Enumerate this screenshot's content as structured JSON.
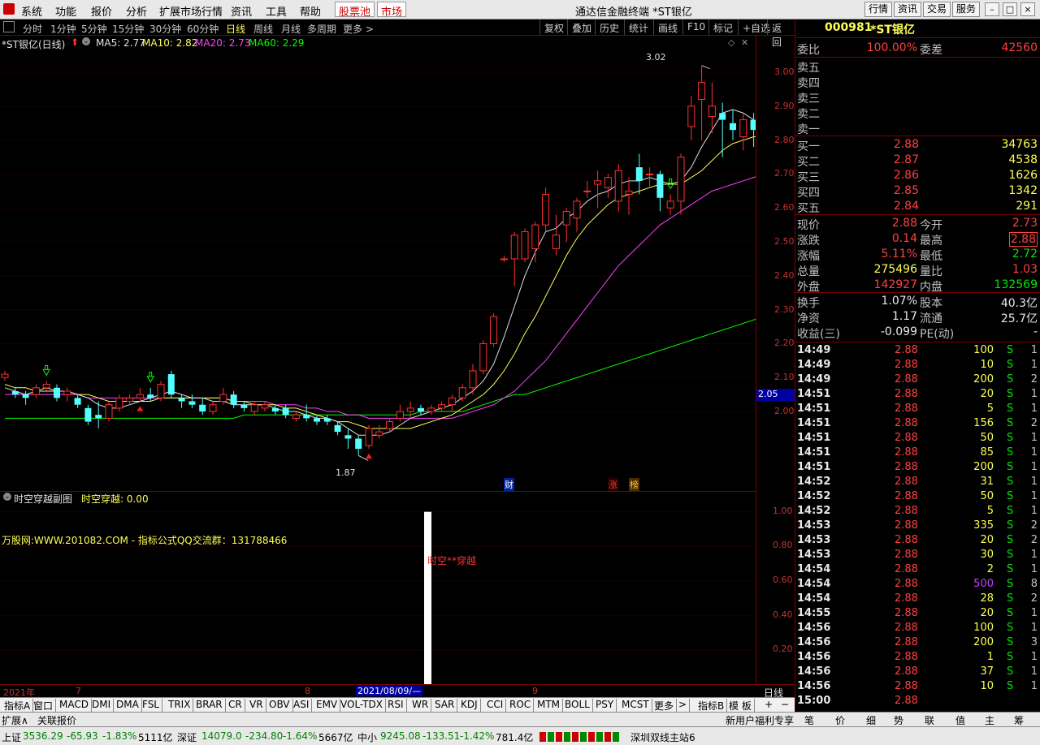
{
  "menubar": {
    "items": [
      "系统",
      "功能",
      "报价",
      "分析",
      "扩展市场行情",
      "资讯",
      "工具",
      "帮助"
    ],
    "tag1": "股票池",
    "tag2": "市场",
    "title": "通达信金融终端 *ST银亿",
    "right_buttons": [
      "行情",
      "资讯",
      "交易",
      "服务"
    ]
  },
  "periodbar": {
    "periods": [
      "分时",
      "1分钟",
      "5分钟",
      "15分钟",
      "30分钟",
      "60分钟",
      "日线",
      "周线",
      "月线",
      "多周期",
      "更多 >"
    ],
    "active": "日线",
    "tools": [
      "复权",
      "叠加",
      "历史",
      "统计",
      "画线",
      "F10",
      "标记",
      "+自选",
      "返回"
    ]
  },
  "chart_header": {
    "title": "*ST银亿(日线)",
    "ma5": "MA5: 2.77",
    "ma10": "MA10: 2.82",
    "ma20": "MA20: 2.73",
    "ma60": "MA60: 2.29",
    "high_label": "3.02",
    "low_label": "1.87",
    "marker_cai": "财",
    "marker_zhang": "涨",
    "marker_bang": "榜"
  },
  "sub_header": {
    "title": "时空穿越副图",
    "value": "时空穿越: 0.00",
    "watermark": "万股网:WWW.201082.COM - 指标公式QQ交流群：131788466",
    "bar_label": "时空**穿越"
  },
  "yaxis": {
    "main": [
      "3.00",
      "2.90",
      "2.80",
      "2.70",
      "2.60",
      "2.50",
      "2.40",
      "2.30",
      "2.20",
      "2.10",
      "2.00"
    ],
    "last": "2.05",
    "sub": [
      "1.00",
      "0.80",
      "0.60",
      "0.40",
      "0.20"
    ]
  },
  "xaxis": {
    "labels": [
      "2021年",
      "7",
      "8",
      "9"
    ],
    "cursor_date": "2021/08/09/—",
    "period": "日线",
    "buttons": [
      "+",
      "−"
    ]
  },
  "tabbar": [
    "指标A",
    "窗口",
    "MACD",
    "DMI",
    "DMA",
    "FSL",
    "TRIX",
    "BRAR",
    "CR",
    "VR",
    "OBV",
    "ASI",
    "EMV",
    "VOL-TDX",
    "RSI",
    "WR",
    "SAR",
    "KDJ",
    "CCI",
    "ROC",
    "MTM",
    "BOLL",
    "PSY",
    "MCST",
    "更多",
    ">",
    "指标B",
    "模 板"
  ],
  "extbar": {
    "left": [
      "扩展∧",
      "关联报价"
    ],
    "right": "新用户福利专享",
    "tabs": [
      "笔",
      "价",
      "细",
      "势",
      "联",
      "值",
      "主",
      "筹"
    ]
  },
  "statusbar": {
    "sh": {
      "name": "上证",
      "val": "3536.29",
      "chg": "-65.93",
      "pct": "-1.83%",
      "amt": "5111亿"
    },
    "sz": {
      "name": "深证",
      "val": "14079.0",
      "chg": "-234.80",
      "pct": "-1.64%",
      "amt": "5667亿"
    },
    "zx": {
      "name": "中小",
      "val": "9245.08",
      "chg": "-133.51",
      "pct": "-1.42%",
      "amt": "781.4亿"
    },
    "server": "深圳双线主站6"
  },
  "quote": {
    "code": "000981",
    "name": "*ST银亿",
    "weibi_label": "委比",
    "weibi": "100.00%",
    "weicha_label": "委差",
    "weicha": "42560",
    "sells": [
      "卖五",
      "卖四",
      "卖三",
      "卖二",
      "卖一"
    ],
    "buys": [
      {
        "label": "买一",
        "price": "2.88",
        "vol": "34763"
      },
      {
        "label": "买二",
        "price": "2.87",
        "vol": "4538"
      },
      {
        "label": "买三",
        "price": "2.86",
        "vol": "1626"
      },
      {
        "label": "买四",
        "price": "2.85",
        "vol": "1342"
      },
      {
        "label": "买五",
        "price": "2.84",
        "vol": "291"
      }
    ],
    "stats": [
      {
        "l1": "现价",
        "v1": "2.88",
        "l2": "今开",
        "v2": "2.73"
      },
      {
        "l1": "涨跌",
        "v1": "0.14",
        "l2": "最高",
        "v2": "2.88"
      },
      {
        "l1": "涨幅",
        "v1": "5.11%",
        "l2": "最低",
        "v2": "2.72"
      },
      {
        "l1": "总量",
        "v1": "275496",
        "l2": "量比",
        "v2": "1.03"
      },
      {
        "l1": "外盘",
        "v1": "142927",
        "l2": "内盘",
        "v2": "132569"
      }
    ],
    "fin": [
      {
        "l1": "换手",
        "v1": "1.07%",
        "l2": "股本",
        "v2": "40.3亿"
      },
      {
        "l1": "净资",
        "v1": "1.17",
        "l2": "流通",
        "v2": "25.7亿"
      },
      {
        "l1": "收益(三)",
        "v1": "-0.099",
        "l2": "PE(动)",
        "v2": "-"
      }
    ],
    "ticks": [
      {
        "t": "14:49",
        "p": "2.88",
        "v": "100",
        "s": "S",
        "n": "1"
      },
      {
        "t": "14:49",
        "p": "2.88",
        "v": "10",
        "s": "S",
        "n": "1"
      },
      {
        "t": "14:49",
        "p": "2.88",
        "v": "200",
        "s": "S",
        "n": "2"
      },
      {
        "t": "14:51",
        "p": "2.88",
        "v": "20",
        "s": "S",
        "n": "1"
      },
      {
        "t": "14:51",
        "p": "2.88",
        "v": "5",
        "s": "S",
        "n": "1"
      },
      {
        "t": "14:51",
        "p": "2.88",
        "v": "156",
        "s": "S",
        "n": "2"
      },
      {
        "t": "14:51",
        "p": "2.88",
        "v": "50",
        "s": "S",
        "n": "1"
      },
      {
        "t": "14:51",
        "p": "2.88",
        "v": "85",
        "s": "S",
        "n": "1"
      },
      {
        "t": "14:51",
        "p": "2.88",
        "v": "200",
        "s": "S",
        "n": "1"
      },
      {
        "t": "14:52",
        "p": "2.88",
        "v": "31",
        "s": "S",
        "n": "1"
      },
      {
        "t": "14:52",
        "p": "2.88",
        "v": "50",
        "s": "S",
        "n": "1"
      },
      {
        "t": "14:52",
        "p": "2.88",
        "v": "5",
        "s": "S",
        "n": "1"
      },
      {
        "t": "14:53",
        "p": "2.88",
        "v": "335",
        "s": "S",
        "n": "2"
      },
      {
        "t": "14:53",
        "p": "2.88",
        "v": "20",
        "s": "S",
        "n": "2"
      },
      {
        "t": "14:53",
        "p": "2.88",
        "v": "30",
        "s": "S",
        "n": "1"
      },
      {
        "t": "14:54",
        "p": "2.88",
        "v": "2",
        "s": "S",
        "n": "1"
      },
      {
        "t": "14:54",
        "p": "2.88",
        "v": "500",
        "s": "S",
        "n": "8"
      },
      {
        "t": "14:54",
        "p": "2.88",
        "v": "28",
        "s": "S",
        "n": "2"
      },
      {
        "t": "14:55",
        "p": "2.88",
        "v": "20",
        "s": "S",
        "n": "1"
      },
      {
        "t": "14:56",
        "p": "2.88",
        "v": "100",
        "s": "S",
        "n": "1"
      },
      {
        "t": "14:56",
        "p": "2.88",
        "v": "200",
        "s": "S",
        "n": "3"
      },
      {
        "t": "14:56",
        "p": "2.88",
        "v": "1",
        "s": "S",
        "n": "1"
      },
      {
        "t": "14:56",
        "p": "2.88",
        "v": "37",
        "s": "S",
        "n": "1"
      },
      {
        "t": "14:56",
        "p": "2.88",
        "v": "10",
        "s": "S",
        "n": "1"
      },
      {
        "t": "15:00",
        "p": "2.88",
        "v": "",
        "s": "",
        "n": ""
      }
    ]
  },
  "chart_data": {
    "type": "candlestick",
    "title": "*ST银亿(日线)",
    "ylim": [
      1.78,
      3.06
    ],
    "ohlc": [
      [
        2.1,
        2.12,
        2.09,
        2.11
      ],
      [
        2.06,
        2.07,
        2.04,
        2.05
      ],
      [
        2.05,
        2.06,
        2.02,
        2.04
      ],
      [
        2.05,
        2.08,
        2.04,
        2.07
      ],
      [
        2.07,
        2.09,
        2.06,
        2.08
      ],
      [
        2.07,
        2.08,
        2.03,
        2.04
      ],
      [
        2.05,
        2.07,
        2.03,
        2.06
      ],
      [
        2.04,
        2.05,
        2.01,
        2.02
      ],
      [
        2.01,
        2.02,
        1.96,
        1.97
      ],
      [
        1.99,
        2.03,
        1.95,
        1.98
      ],
      [
        1.98,
        2.03,
        1.97,
        2.02
      ],
      [
        2.01,
        2.05,
        2.0,
        2.04
      ],
      [
        2.03,
        2.05,
        2.02,
        2.04
      ],
      [
        2.04,
        2.07,
        2.03,
        2.05
      ],
      [
        2.05,
        2.07,
        2.03,
        2.04
      ],
      [
        2.04,
        2.09,
        2.03,
        2.08
      ],
      [
        2.11,
        2.12,
        2.04,
        2.05
      ],
      [
        2.04,
        2.05,
        2.01,
        2.03
      ],
      [
        2.03,
        2.05,
        2.01,
        2.02
      ],
      [
        2.02,
        2.04,
        1.99,
        2.0
      ],
      [
        2.0,
        2.03,
        1.99,
        2.02
      ],
      [
        2.03,
        2.07,
        2.02,
        2.05
      ],
      [
        2.05,
        2.06,
        2.01,
        2.02
      ],
      [
        2.02,
        2.03,
        2.0,
        2.01
      ],
      [
        2.0,
        2.03,
        1.99,
        2.02
      ],
      [
        2.01,
        2.03,
        2.0,
        2.02
      ],
      [
        2.01,
        2.02,
        1.99,
        2.0
      ],
      [
        2.01,
        2.02,
        1.98,
        1.99
      ],
      [
        1.98,
        2.0,
        1.97,
        1.99
      ],
      [
        1.99,
        2.02,
        1.97,
        1.98
      ],
      [
        1.98,
        1.99,
        1.96,
        1.97
      ],
      [
        1.98,
        1.99,
        1.96,
        1.97
      ],
      [
        1.96,
        1.97,
        1.93,
        1.94
      ],
      [
        1.93,
        1.95,
        1.89,
        1.92
      ],
      [
        1.92,
        1.93,
        1.87,
        1.89
      ],
      [
        1.9,
        1.96,
        1.89,
        1.95
      ],
      [
        1.93,
        1.96,
        1.92,
        1.94
      ],
      [
        1.95,
        1.98,
        1.94,
        1.97
      ],
      [
        1.98,
        2.02,
        1.97,
        2.0
      ],
      [
        2.0,
        2.03,
        1.98,
        2.01
      ],
      [
        2.01,
        2.02,
        1.99,
        2.0
      ],
      [
        2.0,
        2.02,
        1.99,
        2.01
      ],
      [
        2.01,
        2.03,
        2.0,
        2.02
      ],
      [
        2.02,
        2.05,
        2.0,
        2.04
      ],
      [
        2.04,
        2.08,
        2.03,
        2.07
      ],
      [
        2.07,
        2.14,
        2.05,
        2.12
      ],
      [
        2.12,
        2.21,
        2.11,
        2.2
      ],
      [
        2.2,
        2.29,
        2.19,
        2.28
      ],
      [
        2.45,
        2.46,
        2.44,
        2.45
      ],
      [
        2.45,
        2.53,
        2.37,
        2.52
      ],
      [
        2.45,
        2.54,
        2.44,
        2.53
      ],
      [
        2.48,
        2.56,
        2.44,
        2.55
      ],
      [
        2.55,
        2.66,
        2.53,
        2.64
      ],
      [
        2.48,
        2.58,
        2.46,
        2.52
      ],
      [
        2.55,
        2.6,
        2.5,
        2.59
      ],
      [
        2.57,
        2.63,
        2.53,
        2.62
      ],
      [
        2.65,
        2.68,
        2.63,
        2.65
      ],
      [
        2.67,
        2.71,
        2.6,
        2.68
      ],
      [
        2.66,
        2.7,
        2.63,
        2.69
      ],
      [
        2.62,
        2.73,
        2.59,
        2.71
      ],
      [
        2.64,
        2.69,
        2.58,
        2.65
      ],
      [
        2.72,
        2.76,
        2.64,
        2.68
      ],
      [
        2.7,
        2.72,
        2.66,
        2.7
      ],
      [
        2.7,
        2.71,
        2.59,
        2.63
      ],
      [
        2.6,
        2.64,
        2.58,
        2.62
      ],
      [
        2.62,
        2.76,
        2.58,
        2.75
      ],
      [
        2.84,
        2.93,
        2.8,
        2.9
      ],
      [
        2.92,
        3.02,
        2.8,
        2.97
      ],
      [
        2.87,
        2.97,
        2.82,
        2.9
      ],
      [
        2.88,
        2.91,
        2.75,
        2.86
      ],
      [
        2.85,
        2.89,
        2.8,
        2.83
      ],
      [
        2.81,
        2.88,
        2.77,
        2.86
      ],
      [
        2.86,
        2.88,
        2.78,
        2.83
      ],
      [
        2.82,
        2.85,
        2.76,
        2.8
      ],
      [
        2.78,
        2.82,
        2.62,
        2.66
      ],
      [
        2.75,
        2.78,
        2.51,
        2.65
      ],
      [
        2.72,
        2.88,
        2.72,
        2.88
      ]
    ],
    "ma5": [
      2.07,
      2.06,
      2.05,
      2.06,
      2.07,
      2.06,
      2.06,
      2.05,
      2.04,
      2.02,
      2.01,
      2.01,
      2.02,
      2.03,
      2.04,
      2.05,
      2.06,
      2.05,
      2.04,
      2.04,
      2.03,
      2.03,
      2.02,
      2.02,
      2.02,
      2.02,
      2.01,
      2.0,
      2.0,
      1.99,
      1.98,
      1.98,
      1.97,
      1.95,
      1.93,
      1.93,
      1.93,
      1.94,
      1.96,
      1.98,
      1.99,
      2.0,
      2.01,
      2.02,
      2.04,
      2.06,
      2.09,
      2.14,
      2.22,
      2.31,
      2.4,
      2.47,
      2.53,
      2.54,
      2.57,
      2.59,
      2.62,
      2.64,
      2.65,
      2.67,
      2.68,
      2.68,
      2.69,
      2.68,
      2.67,
      2.68,
      2.72,
      2.78,
      2.83,
      2.88,
      2.89,
      2.88,
      2.86,
      2.83,
      2.8,
      2.77,
      2.78
    ],
    "ma10": [
      2.08,
      2.07,
      2.07,
      2.06,
      2.06,
      2.06,
      2.06,
      2.05,
      2.05,
      2.04,
      2.03,
      2.03,
      2.03,
      2.03,
      2.03,
      2.04,
      2.04,
      2.04,
      2.04,
      2.04,
      2.04,
      2.04,
      2.03,
      2.03,
      2.02,
      2.02,
      2.02,
      2.01,
      2.01,
      2.0,
      1.99,
      1.98,
      1.97,
      1.97,
      1.96,
      1.95,
      1.95,
      1.95,
      1.95,
      1.95,
      1.96,
      1.97,
      1.98,
      1.99,
      2.01,
      2.03,
      2.05,
      2.08,
      2.12,
      2.17,
      2.23,
      2.28,
      2.34,
      2.4,
      2.46,
      2.51,
      2.55,
      2.58,
      2.61,
      2.63,
      2.64,
      2.65,
      2.66,
      2.67,
      2.67,
      2.67,
      2.69,
      2.71,
      2.74,
      2.77,
      2.79,
      2.8,
      2.81,
      2.81,
      2.8,
      2.8,
      2.82
    ],
    "ma20": [
      2.05,
      2.05,
      2.05,
      2.05,
      2.05,
      2.05,
      2.05,
      2.05,
      2.04,
      2.04,
      2.04,
      2.04,
      2.04,
      2.04,
      2.04,
      2.04,
      2.04,
      2.04,
      2.04,
      2.04,
      2.04,
      2.04,
      2.03,
      2.03,
      2.03,
      2.03,
      2.02,
      2.02,
      2.02,
      2.01,
      2.01,
      2.0,
      2.0,
      1.99,
      1.99,
      1.98,
      1.98,
      1.98,
      1.98,
      1.98,
      1.98,
      1.98,
      1.98,
      1.98,
      1.99,
      2.0,
      2.01,
      2.02,
      2.04,
      2.06,
      2.09,
      2.12,
      2.15,
      2.19,
      2.23,
      2.27,
      2.31,
      2.35,
      2.39,
      2.43,
      2.46,
      2.49,
      2.52,
      2.55,
      2.57,
      2.59,
      2.61,
      2.63,
      2.65,
      2.66,
      2.67,
      2.68,
      2.69,
      2.7,
      2.7,
      2.71,
      2.73
    ],
    "ma60": [
      1.98,
      1.98,
      1.98,
      1.98,
      1.98,
      1.98,
      1.98,
      1.98,
      1.98,
      1.98,
      1.98,
      1.98,
      1.98,
      1.98,
      1.98,
      1.98,
      1.98,
      1.98,
      1.98,
      1.98,
      1.98,
      1.98,
      1.98,
      1.99,
      1.99,
      1.99,
      1.99,
      1.99,
      1.99,
      1.99,
      1.99,
      1.99,
      1.99,
      1.99,
      1.99,
      1.99,
      1.99,
      1.99,
      1.99,
      1.99,
      2.0,
      2.0,
      2.0,
      2.0,
      2.0,
      2.01,
      2.02,
      2.03,
      2.04,
      2.05,
      2.05,
      2.06,
      2.07,
      2.08,
      2.09,
      2.1,
      2.11,
      2.12,
      2.13,
      2.14,
      2.15,
      2.16,
      2.17,
      2.18,
      2.19,
      2.2,
      2.21,
      2.22,
      2.23,
      2.24,
      2.25,
      2.26,
      2.27,
      2.28,
      2.28,
      2.29,
      2.29
    ],
    "sub_bar": {
      "index": 40,
      "value": 1.0
    },
    "sub_ylim": [
      0,
      1.05
    ]
  }
}
